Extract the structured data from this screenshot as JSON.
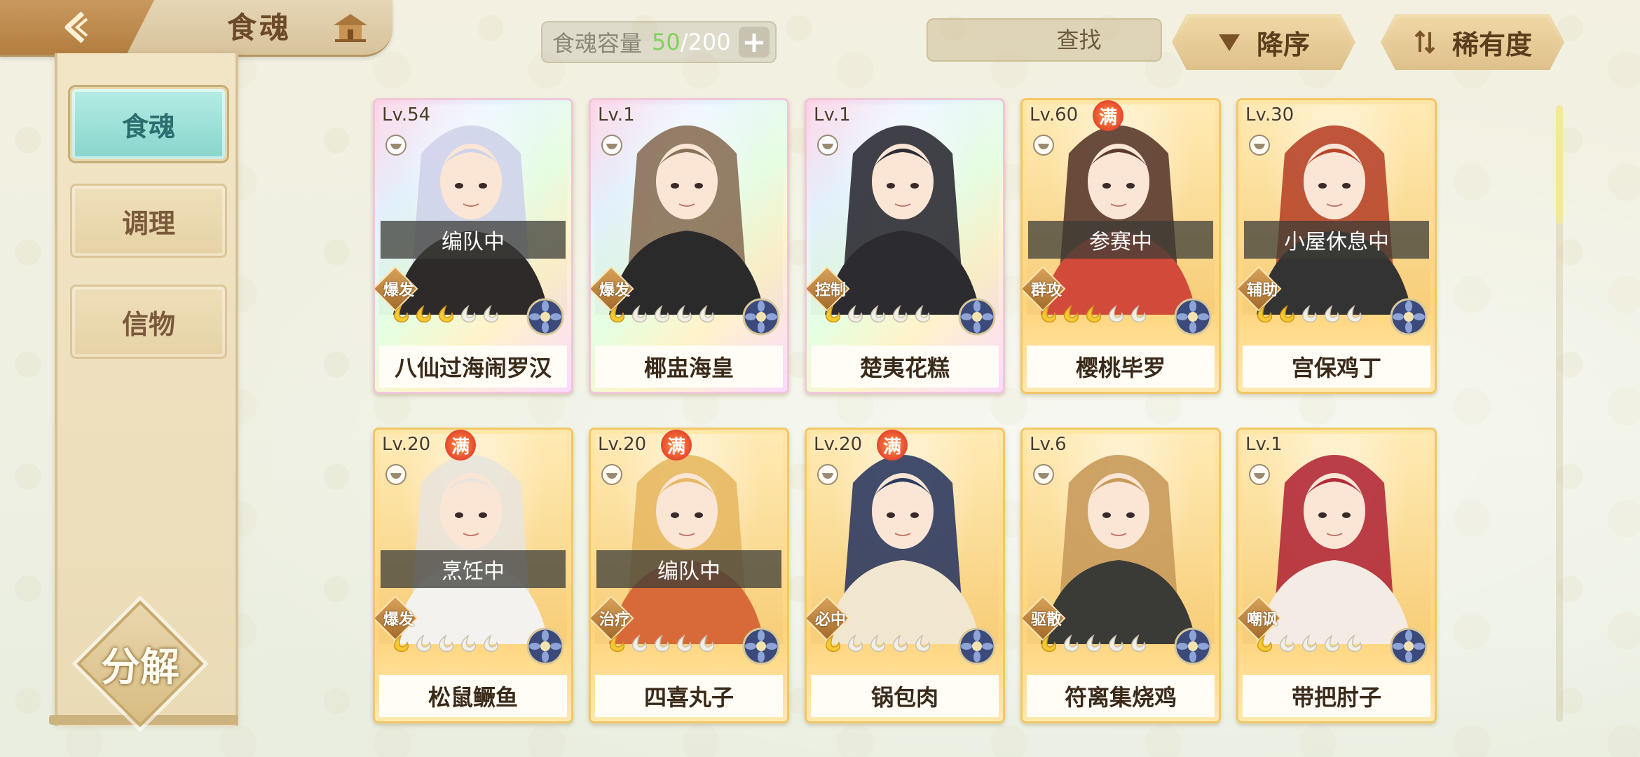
{
  "header": {
    "section_title": "食魂",
    "capacity_label": "食魂容量",
    "capacity_current": "50",
    "capacity_sep": "/",
    "capacity_max": "200",
    "search_placeholder": "查找",
    "sort_desc_label": "降序",
    "sort_rarity_label": "稀有度"
  },
  "sidebar": {
    "tabs": [
      {
        "label": "食魂",
        "active": true
      },
      {
        "label": "调理",
        "active": false
      },
      {
        "label": "信物",
        "active": false
      }
    ],
    "decompose_label": "分解"
  },
  "cards": [
    {
      "level": "Lv.54",
      "full": false,
      "status": "编队中",
      "role": "爆发",
      "stars": 3,
      "name": "八仙过海闹罗汉",
      "rarity": "rainbow"
    },
    {
      "level": "Lv.1",
      "full": false,
      "status": "",
      "role": "爆发",
      "stars": 1,
      "name": "椰盅海皇",
      "rarity": "rainbow"
    },
    {
      "level": "Lv.1",
      "full": false,
      "status": "",
      "role": "控制",
      "stars": 1,
      "name": "楚夷花糕",
      "rarity": "rainbow"
    },
    {
      "level": "Lv.60",
      "full": true,
      "full_label": "满",
      "status": "参赛中",
      "role": "群攻",
      "stars": 3,
      "name": "樱桃毕罗",
      "rarity": "gold"
    },
    {
      "level": "Lv.30",
      "full": false,
      "status": "小屋休息中",
      "role": "辅助",
      "stars": 2,
      "name": "宫保鸡丁",
      "rarity": "gold"
    },
    {
      "level": "Lv.20",
      "full": true,
      "full_label": "满",
      "status": "烹饪中",
      "role": "爆发",
      "stars": 1,
      "name": "松鼠鳜鱼",
      "rarity": "gold"
    },
    {
      "level": "Lv.20",
      "full": true,
      "full_label": "满",
      "status": "编队中",
      "role": "治疗",
      "stars": 1,
      "name": "四喜丸子",
      "rarity": "gold"
    },
    {
      "level": "Lv.20",
      "full": true,
      "full_label": "满",
      "status": "",
      "role": "必中",
      "stars": 1,
      "name": "锅包肉",
      "rarity": "gold"
    },
    {
      "level": "Lv.6",
      "full": false,
      "status": "",
      "role": "驱散",
      "stars": 1,
      "name": "符离集烧鸡",
      "rarity": "gold"
    },
    {
      "level": "Lv.1",
      "full": false,
      "status": "",
      "role": "嘲讽",
      "stars": 1,
      "name": "带把肘子",
      "rarity": "gold"
    }
  ],
  "colors": {
    "accent_teal": "#88d4cc",
    "gold_frame": "#f3c767",
    "capacity_green": "#7fd15b",
    "status_overlay": "#3c3c37"
  }
}
